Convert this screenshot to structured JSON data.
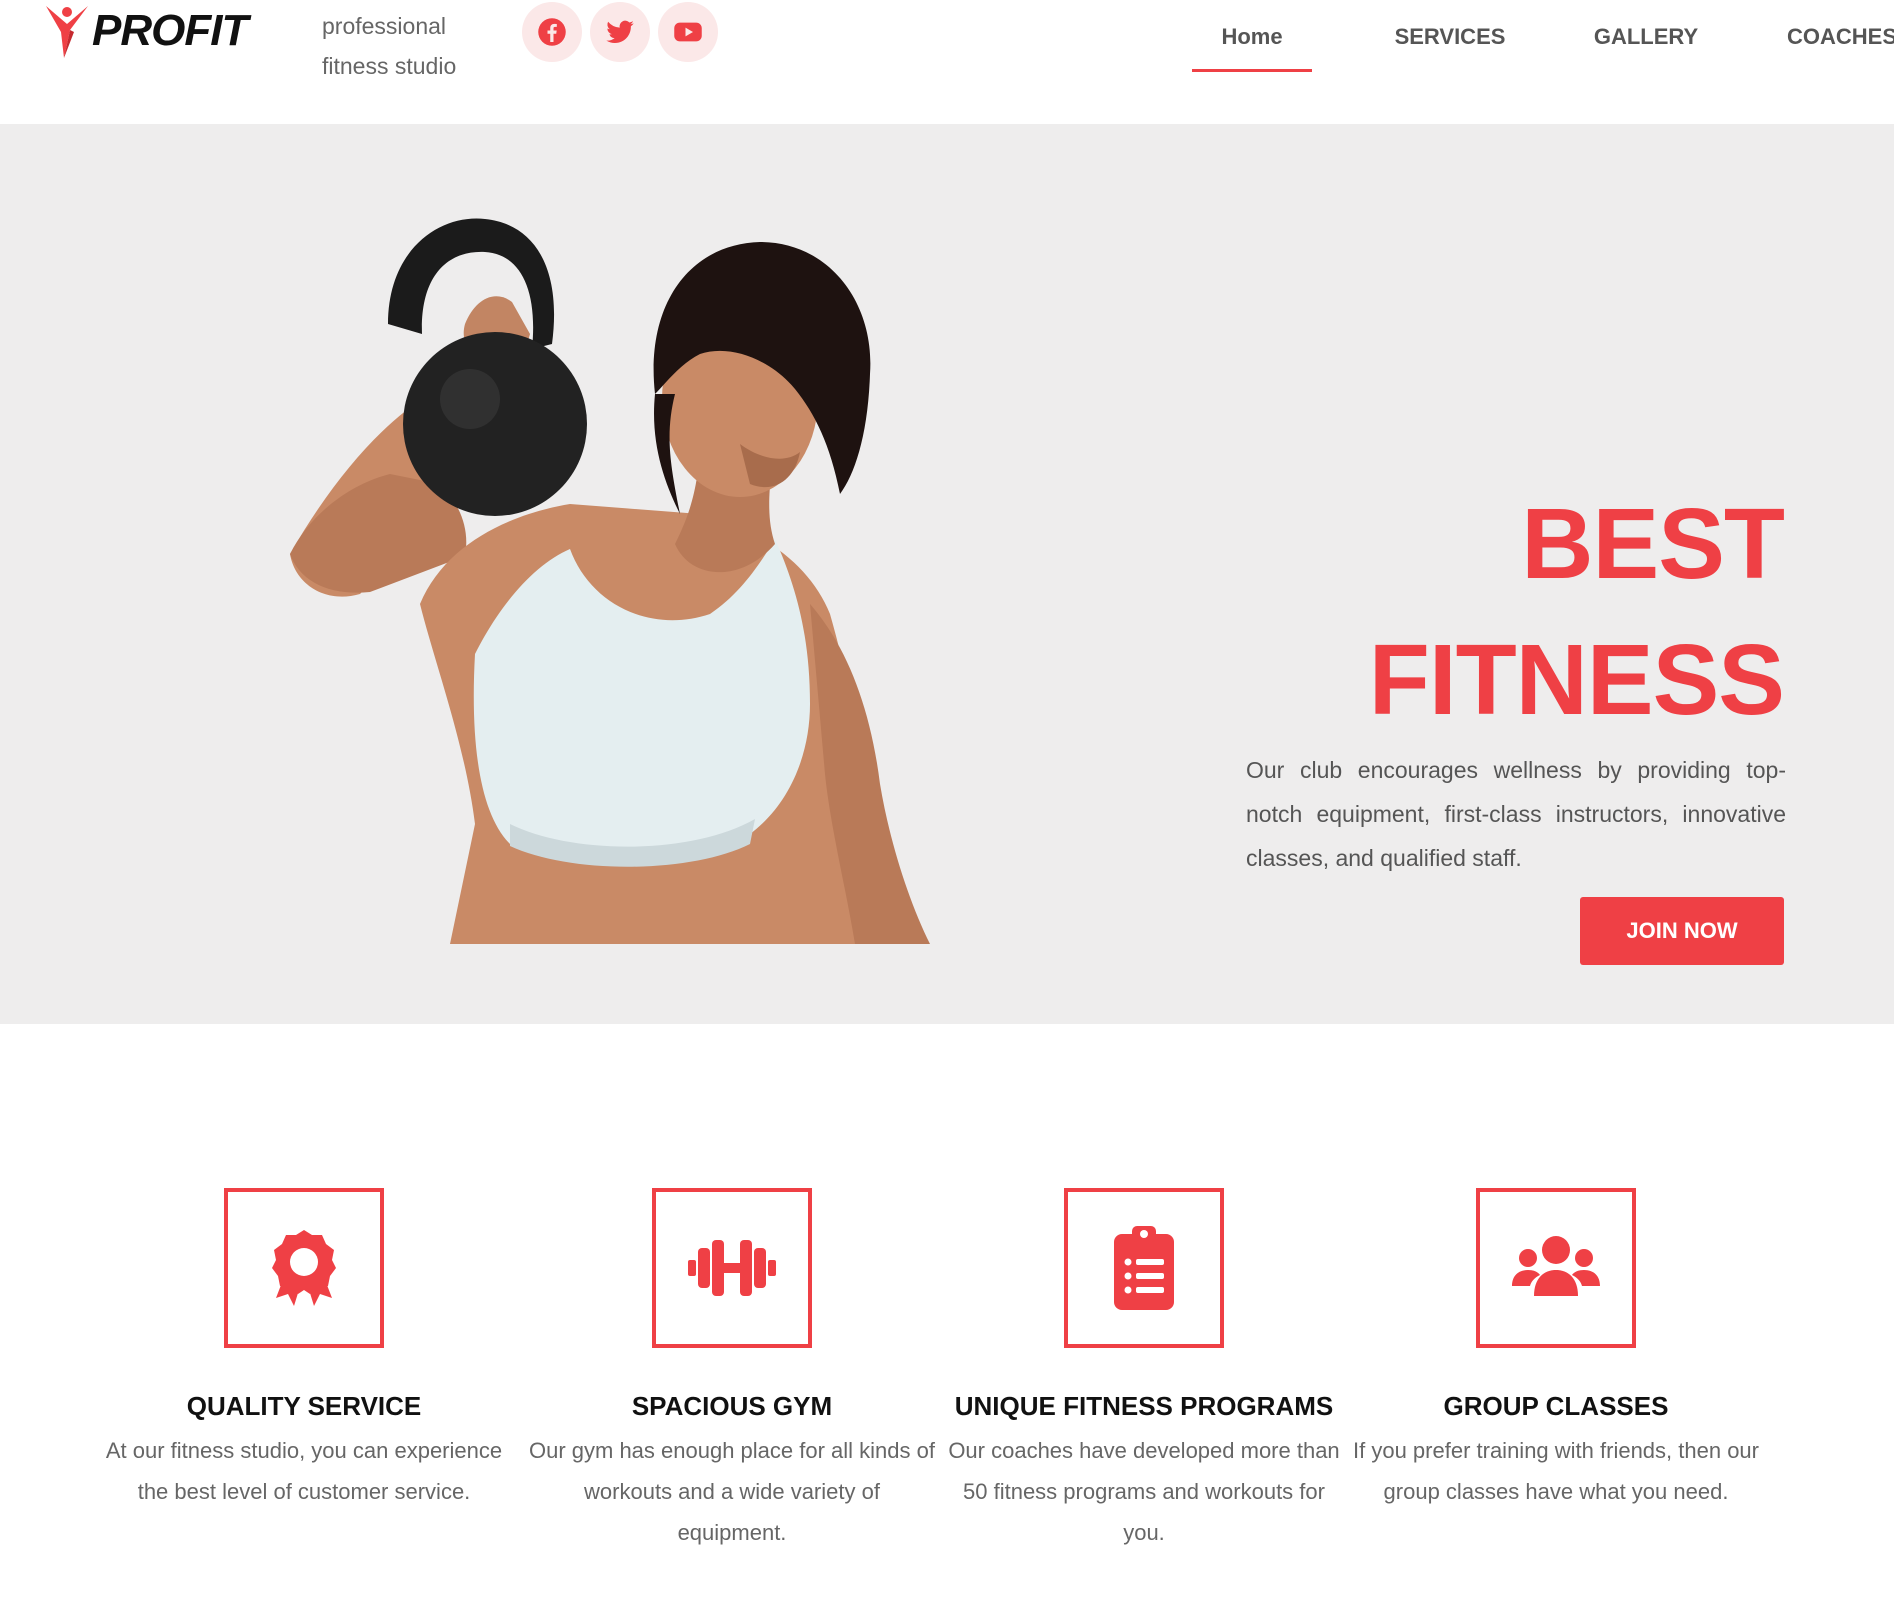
{
  "brand": {
    "name": "PROFIT",
    "tagline": "professional fitness studio",
    "accent_color": "#ef4045"
  },
  "socials": [
    {
      "icon": "facebook-icon"
    },
    {
      "icon": "twitter-icon"
    },
    {
      "icon": "youtube-icon"
    }
  ],
  "nav": {
    "items": [
      {
        "label": "Home",
        "active": true
      },
      {
        "label": "SERVICES",
        "active": false
      },
      {
        "label": "GALLERY",
        "active": false
      },
      {
        "label": "COACHES",
        "active": false
      }
    ]
  },
  "hero": {
    "title_line1": "BEST",
    "title_line2": "FITNESS",
    "description": "Our club encourages wellness by providing top-notch equipment, first-class instructors, innovative classes, and qualified staff.",
    "cta_label": "JOIN NOW",
    "background_color": "#eeeded"
  },
  "features": [
    {
      "icon": "award-ribbon-icon",
      "title": "QUALITY SERVICE",
      "text": "At our fitness studio, you can experience the best level of customer service."
    },
    {
      "icon": "dumbbell-icon",
      "title": "SPACIOUS GYM",
      "text": "Our gym has enough place for all kinds of workouts and a wide variety of equipment."
    },
    {
      "icon": "clipboard-list-icon",
      "title": "UNIQUE FITNESS PROGRAMS",
      "text": "Our coaches have developed more than 50 fitness programs and workouts for you."
    },
    {
      "icon": "group-users-icon",
      "title": "GROUP CLASSES",
      "text": "If you prefer training with friends, then our group classes have what you need."
    }
  ]
}
